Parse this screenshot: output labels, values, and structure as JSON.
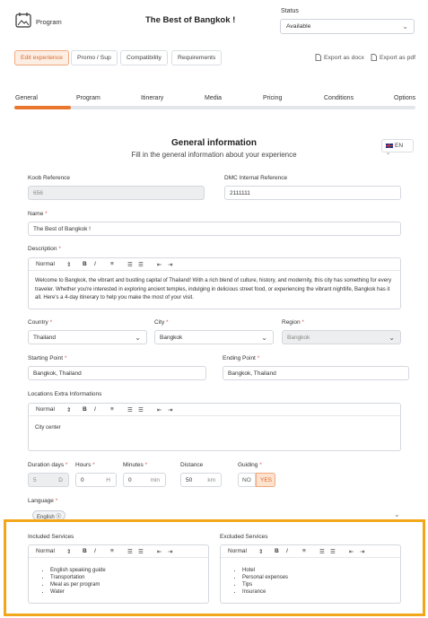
{
  "header": {
    "crumb": "Program",
    "title": "The Best of Bangkok !",
    "status_label": "Status",
    "status_value": "Available"
  },
  "buttons": {
    "edit": "Edit experience",
    "promo": "Promo / Sup",
    "compat": "Compatibility",
    "req": "Requirements",
    "export_docx": "Export as docx",
    "export_pdf": "Export as pdf"
  },
  "tabs": [
    "General",
    "Program",
    "Itinerary",
    "Media",
    "Pricing",
    "Conditions",
    "Options"
  ],
  "progress_fraction": 0.14,
  "section": {
    "title": "General information",
    "subtitle": "Fill in the general information about your experience",
    "lang": "EN"
  },
  "form": {
    "koob_ref_label": "Koob Reference",
    "koob_ref_value": "656",
    "dmc_ref_label": "DMC Internal Reference",
    "dmc_ref_value": "2111111",
    "name_label": "Name",
    "name_value": "The Best of Bangkok !",
    "desc_label": "Description",
    "desc_text": "Welcome to Bangkok, the vibrant and bustling capital of Thailand! With a rich blend of culture, history, and modernity, this city has something for every traveler. Whether you're interested in exploring ancient temples, indulging in delicious street food, or experiencing the vibrant nightlife, Bangkok has it all. Here's a 4-day itinerary to help you make the most of your visit.",
    "country_label": "Country",
    "country_value": "Thailand",
    "city_label": "City",
    "city_value": "Bangkok",
    "region_label": "Region",
    "region_value": "Bangkok",
    "start_label": "Starting Point",
    "start_value": "Bangkok, Thailand",
    "end_label": "Ending Point",
    "end_value": "Bangkok, Thailand",
    "loc_label": "Locations Extra Informations",
    "loc_text": "City center",
    "duration_label": "Duration days",
    "duration_value": "5",
    "duration_unit": "D",
    "hours_label": "Hours",
    "hours_value": "0",
    "hours_unit": "H",
    "minutes_label": "Minutes",
    "minutes_value": "0",
    "minutes_unit": "min",
    "distance_label": "Distance",
    "distance_value": "50",
    "distance_unit": "km",
    "guiding_label": "Guiding",
    "guiding_no": "NO",
    "guiding_yes": "YES",
    "language_label": "Language",
    "language_tag": "English",
    "included_label": "Included Services",
    "included": [
      "English speaking guide",
      "Transportation",
      "Meal as per program",
      "Water"
    ],
    "excluded_label": "Excluded Services",
    "excluded": [
      "Hotel",
      "Personal expenses",
      "Tips",
      "Insurance"
    ]
  },
  "editor": {
    "style": "Normal",
    "updown": "⇕",
    "bold": "B",
    "italic": "I",
    "align": "≡",
    "ol": "☰",
    "ul": "☰",
    "indent_out": "⇤",
    "indent_in": "⇥"
  },
  "required_mark": "*",
  "colors": {
    "accent": "#e8762d",
    "highlight": "#f2a71b"
  }
}
